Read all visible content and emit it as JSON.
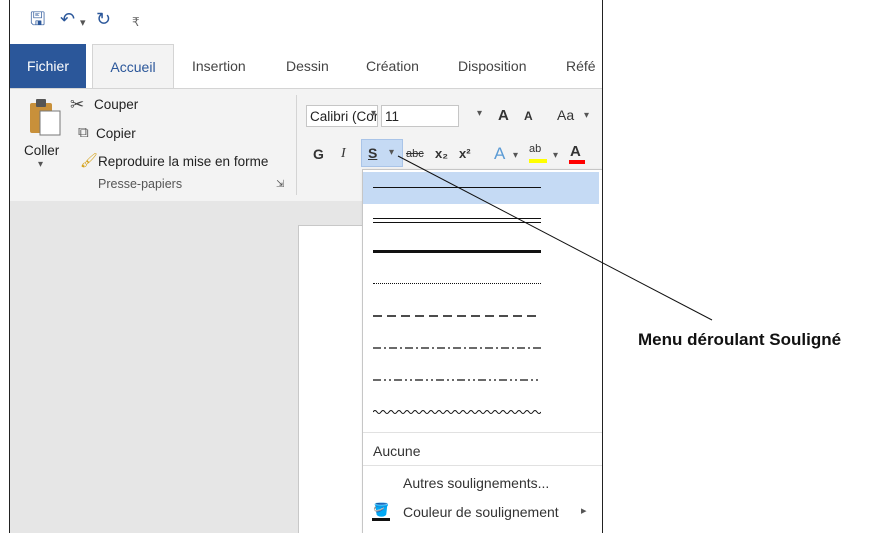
{
  "qat": {
    "save": "🖫",
    "undo": "↶",
    "undo_dd": "▾",
    "redo": "↻",
    "customize": "₹"
  },
  "tabs": [
    "Fichier",
    "Accueil",
    "Insertion",
    "Dessin",
    "Création",
    "Disposition",
    "Réfé"
  ],
  "clipboard": {
    "paste_label": "Coller",
    "paste_dd": "▾",
    "cut_label": "Couper",
    "copy_label": "Copier",
    "format_painter_label": "Reproduire la mise en forme",
    "group_label": "Presse-papiers",
    "launcher": "⇲"
  },
  "font": {
    "name_value": "Calibri (Corp",
    "size_value": "11",
    "grow": "A",
    "shrink": "A",
    "case": "Aa",
    "bold": "G",
    "italic": "I",
    "underline": "S",
    "dd": "▾",
    "strike": "abc",
    "sub": "x₂",
    "sup": "x²",
    "effects": "A",
    "highlight": "ab",
    "color": "A"
  },
  "underline_menu": {
    "styles": [
      "single",
      "double",
      "thick",
      "dotted",
      "dashed",
      "dash-dot",
      "dash-dot-dot",
      "wave"
    ],
    "none_label": "Aucune",
    "more_label": "Autres soulignements...",
    "color_label": "Couleur de soulignement",
    "submenu_arrow": "▸"
  },
  "callout": {
    "text": "Menu déroulant Souligné"
  },
  "colors": {
    "brand": "#2b579a",
    "highlight_bar": "#ffff00",
    "font_color_bar": "#ff0000",
    "selected": "#c5daf4"
  }
}
